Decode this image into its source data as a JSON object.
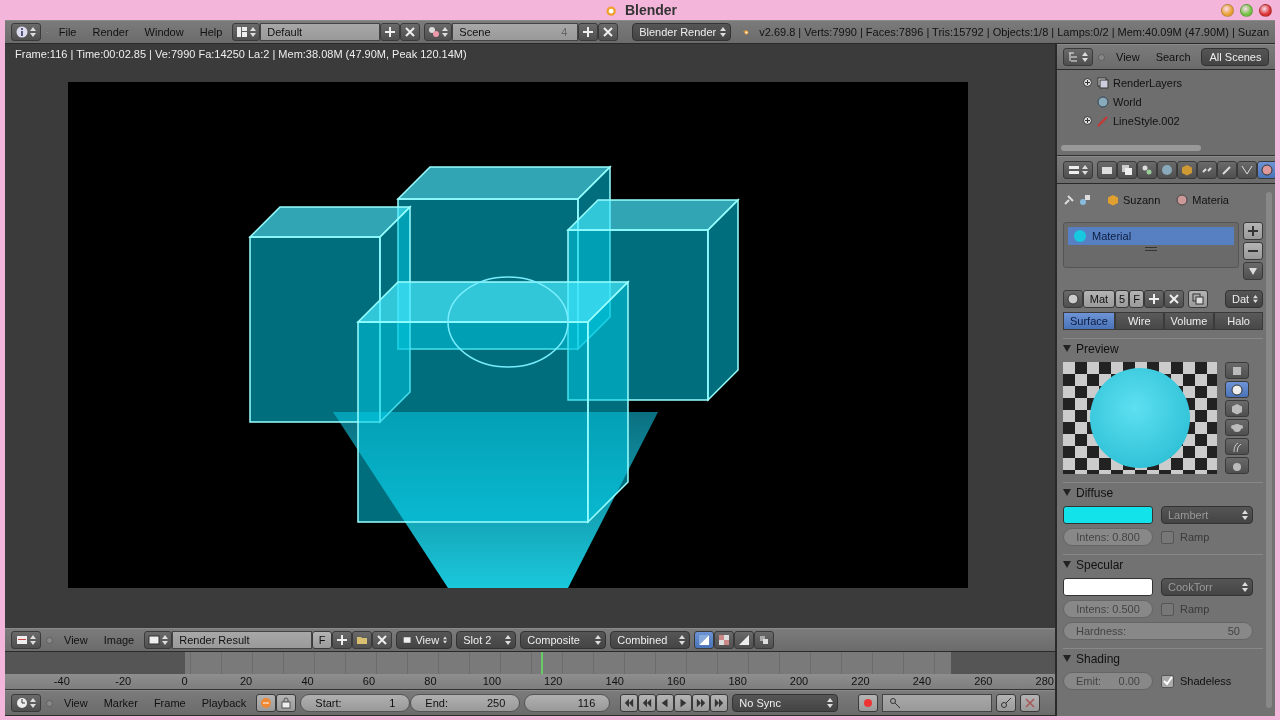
{
  "window": {
    "title": "Blender"
  },
  "top_header": {
    "menus": [
      "File",
      "Render",
      "Window",
      "Help"
    ],
    "layout": "Default",
    "scene": "Scene",
    "scene_users": "4",
    "engine": "Blender Render",
    "stats": "v2.69.8 | Verts:7990 | Faces:7896 | Tris:15792 | Objects:1/8 | Lamps:0/2 | Mem:40.09M (47.90M) | Suzan"
  },
  "image_editor": {
    "info": "Frame:116 | Time:00:02.85 | Ve:7990 Fa:14250 La:2 | Mem:38.08M (47.90M, Peak 120.14M)",
    "header": {
      "menus": [
        "View",
        "Image"
      ],
      "image": "Render Result",
      "fake_user": "F",
      "view": "View",
      "slot": "Slot 2",
      "layer": "Composite",
      "pass": "Combined",
      "draw_modes": [
        {
          "kind": "color_alpha",
          "selected": true
        },
        {
          "kind": "alpha",
          "selected": false
        },
        {
          "kind": "z",
          "selected": false
        },
        {
          "kind": "channels",
          "selected": false
        }
      ]
    }
  },
  "timeline": {
    "ruler": [
      "-40",
      "-20",
      "0",
      "20",
      "40",
      "60",
      "80",
      "100",
      "120",
      "140",
      "160",
      "180",
      "200",
      "220",
      "240",
      "260",
      "280"
    ],
    "cursor": {
      "level": 0.51
    },
    "header": {
      "menus": [
        "View",
        "Marker",
        "Frame",
        "Playback"
      ],
      "start_label": "Start:",
      "start": "1",
      "end_label": "End:",
      "end": "250",
      "current": "116",
      "sync": "No Sync"
    }
  },
  "outliner": {
    "menus": [
      "View",
      "Search"
    ],
    "filter": "All Scenes",
    "items": [
      {
        "kind": "render_layers",
        "label": "RenderLayers",
        "expanded": false
      },
      {
        "kind": "world",
        "label": "World"
      },
      {
        "kind": "line_style",
        "label": "LineStyle.002",
        "expanded": false
      }
    ]
  },
  "properties": {
    "tabs": [
      {
        "kind": "render",
        "selected": false
      },
      {
        "kind": "layers",
        "selected": false
      },
      {
        "kind": "scene",
        "selected": false
      },
      {
        "kind": "world",
        "selected": false
      },
      {
        "kind": "object",
        "selected": false
      },
      {
        "kind": "constraints",
        "selected": false
      },
      {
        "kind": "modifiers",
        "selected": false
      },
      {
        "kind": "data",
        "selected": false
      },
      {
        "kind": "material",
        "selected": true
      }
    ],
    "breadcrumb": [
      "Suzann",
      "Materia"
    ],
    "slots": [
      {
        "name": "Material",
        "selected": true,
        "color": "#18c8e0"
      }
    ],
    "datablock": {
      "name": "Mat",
      "users": "5",
      "fake_user": "F",
      "link": "Dat"
    },
    "type_tabs": [
      {
        "label": "Surface",
        "selected": true
      },
      {
        "label": "Wire",
        "selected": false
      },
      {
        "label": "Volume",
        "selected": false
      },
      {
        "label": "Halo",
        "selected": false
      }
    ],
    "preview": {
      "title": "Preview",
      "shapes": [
        {
          "kind": "flat",
          "selected": false
        },
        {
          "kind": "sphere",
          "selected": true
        },
        {
          "kind": "cube",
          "selected": false
        },
        {
          "kind": "monkey",
          "selected": false
        },
        {
          "kind": "hair",
          "selected": false
        },
        {
          "kind": "sky",
          "selected": false
        }
      ]
    },
    "diffuse": {
      "title": "Diffuse",
      "color": "#12e2ea",
      "shader": "Lambert",
      "intensity": "Intens: 0.800",
      "ramp": {
        "label": "Ramp",
        "checked": false
      }
    },
    "specular": {
      "title": "Specular",
      "color": "#ffffff",
      "shader": "CookTorr",
      "intensity": "Intens: 0.500",
      "ramp": {
        "label": "Ramp",
        "checked": false
      },
      "hardness_label": "Hardness:",
      "hardness": "50"
    },
    "shading": {
      "title": "Shading",
      "emit_label": "Emit:",
      "emit": "0.00",
      "shadeless": {
        "label": "Shadeless",
        "checked": true
      }
    }
  }
}
